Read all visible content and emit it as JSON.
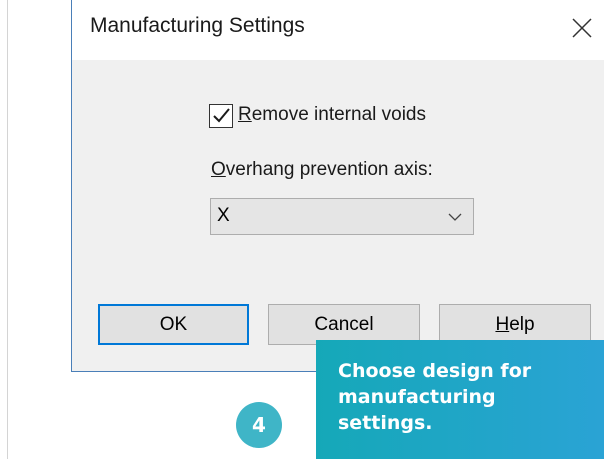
{
  "dialog": {
    "title": "Manufacturing Settings",
    "close_icon": "close-icon",
    "remove_voids": {
      "checked": true,
      "label_accel": "R",
      "label_rest": "emove internal voids"
    },
    "overhang": {
      "label_accel": "O",
      "label_rest": "verhang prevention axis:",
      "selected": "X",
      "dropdown_icon": "chevron-down-icon"
    },
    "buttons": {
      "ok": "OK",
      "cancel": "Cancel",
      "help_accel": "H",
      "help_rest": "elp"
    }
  },
  "tutorial": {
    "step_number": "4",
    "callout_text": "Choose design for manufacturing settings.",
    "accent_color": "#1fa7c6"
  }
}
